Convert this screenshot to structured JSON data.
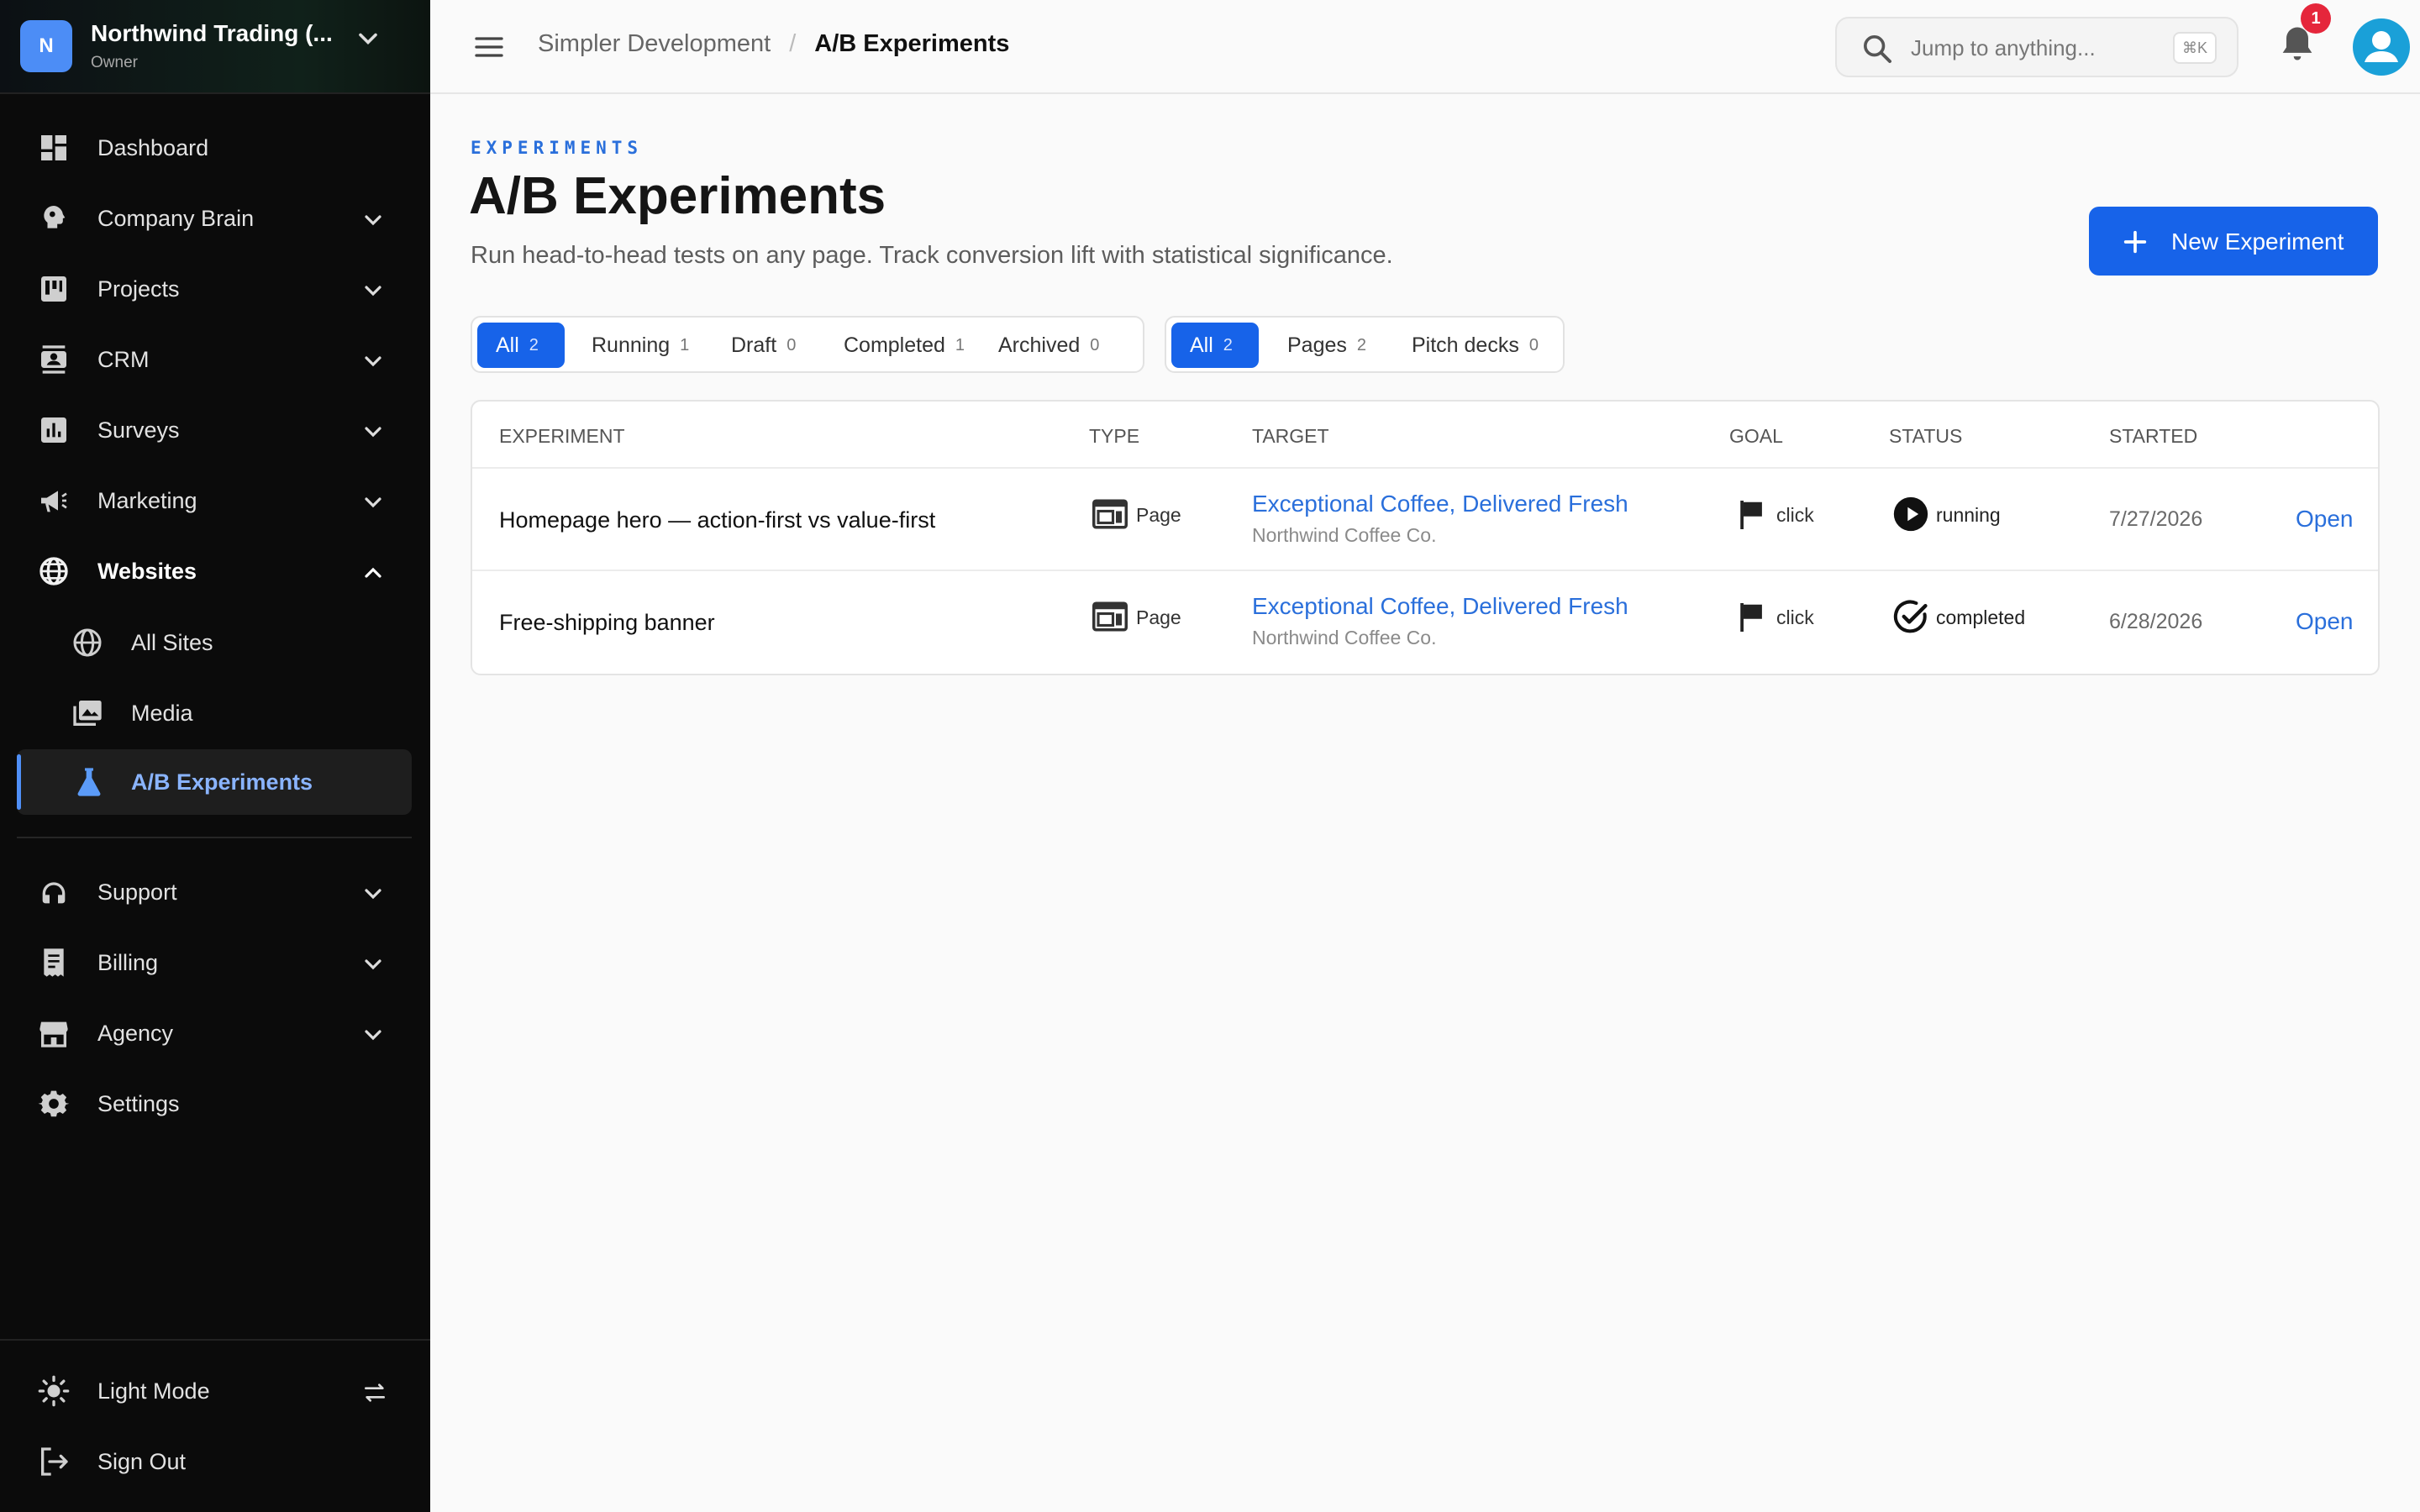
{
  "org": {
    "initial": "N",
    "name": "Northwind Trading (...",
    "role": "Owner"
  },
  "nav": [
    {
      "label": "Dashboard"
    },
    {
      "label": "Company Brain"
    },
    {
      "label": "Projects"
    },
    {
      "label": "CRM"
    },
    {
      "label": "Surveys"
    },
    {
      "label": "Marketing"
    },
    {
      "label": "Websites"
    },
    {
      "label": "Support"
    },
    {
      "label": "Billing"
    },
    {
      "label": "Agency"
    },
    {
      "label": "Settings"
    }
  ],
  "websites_sub": [
    {
      "label": "All Sites"
    },
    {
      "label": "Media"
    },
    {
      "label": "A/B Experiments",
      "active": true
    }
  ],
  "bottom": {
    "light_mode": "Light Mode",
    "sign_out": "Sign Out"
  },
  "topbar": {
    "breadcrumb_parent": "Simpler Development",
    "breadcrumb_sep": "/",
    "breadcrumb_current": "A/B Experiments",
    "search_placeholder": "Jump to anything...",
    "search_shortcut": "⌘K",
    "notification_count": "1"
  },
  "header": {
    "eyebrow": "EXPERIMENTS",
    "title": "A/B Experiments",
    "subtitle": "Run head-to-head tests on any page. Track conversion lift with statistical significance.",
    "new_button": "New Experiment"
  },
  "status_filters": [
    {
      "label": "All",
      "count": "2",
      "active": true
    },
    {
      "label": "Running",
      "count": "1"
    },
    {
      "label": "Draft",
      "count": "0"
    },
    {
      "label": "Completed",
      "count": "1"
    },
    {
      "label": "Archived",
      "count": "0"
    }
  ],
  "type_filters": [
    {
      "label": "All",
      "count": "2",
      "active": true
    },
    {
      "label": "Pages",
      "count": "2"
    },
    {
      "label": "Pitch decks",
      "count": "0"
    }
  ],
  "table": {
    "columns": [
      "EXPERIMENT",
      "TYPE",
      "TARGET",
      "GOAL",
      "STATUS",
      "STARTED"
    ],
    "rows": [
      {
        "name": "Homepage hero — action-first vs value-first",
        "type": "Page",
        "target_title": "Exceptional Coffee, Delivered Fresh",
        "target_sub": "Northwind Coffee Co.",
        "goal": "click",
        "status": "running",
        "started": "7/27/2026",
        "action": "Open"
      },
      {
        "name": "Free-shipping banner",
        "type": "Page",
        "target_title": "Exceptional Coffee, Delivered Fresh",
        "target_sub": "Northwind Coffee Co.",
        "goal": "click",
        "status": "completed",
        "started": "6/28/2026",
        "action": "Open"
      }
    ]
  },
  "colors": {
    "accent": "#1763e9",
    "link": "#2a6fdb",
    "sidebar_bg": "#0b0b0b",
    "badge_red": "#e5263b"
  }
}
